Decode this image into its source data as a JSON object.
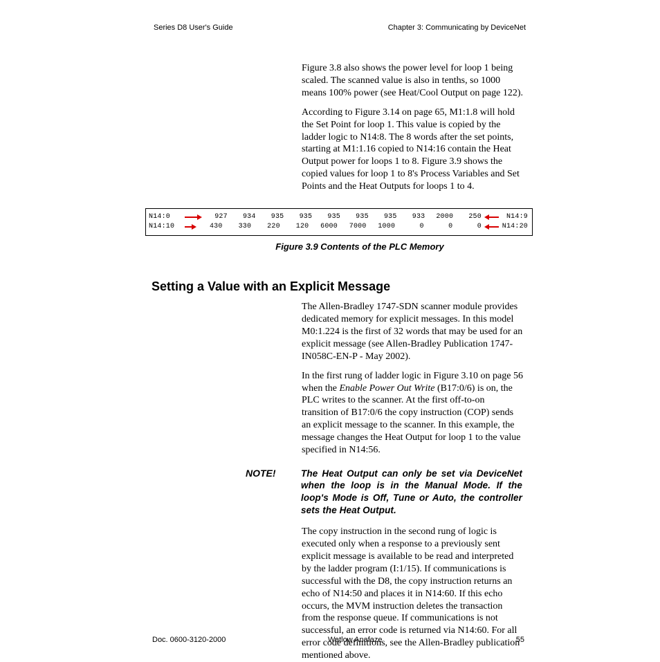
{
  "header": {
    "left": "Series D8 User's Guide",
    "right": "Chapter 3: Communicating by DeviceNet"
  },
  "body": {
    "para1": "Figure 3.8 also shows the power level for loop 1 being scaled. The scanned value is also in tenths, so 1000 means 100% power (see Heat/Cool Output on page 122).",
    "para2": "According to Figure 3.14 on page 65, M1:1.8 will hold the Set Point for loop 1. This value is copied by the ladder logic to N14:8. The 8 words after the set points, starting at M1:1.16 copied to N14:16 contain the Heat Output power for loops 1 to 8. Figure 3.9 shows the copied values for loop 1 to 8's Process Variables and Set Points and the Heat Outputs for loops 1 to 4.",
    "para3_a": "The Allen-Bradley 1747-SDN scanner module provides dedicated memory for explicit messages. In this model M0:1.224 is the first of 32 words that may be used for an explicit message (see Allen-Bradley Publication 1747-IN058C-EN-P - May 2002).",
    "para3_b_pre": "In the first rung of ladder logic in Figure 3.10 on page 56 when the ",
    "para3_b_em": "Enable Power Out Write",
    "para3_b_post": " (B17:0/6) is on, the PLC writes to the scanner. At the first off-to-on transition of B17:0/6 the copy instruction (COP) sends an explicit message to the scanner. In this example, the message changes the Heat Output for loop 1 to the value specified in N14:56.",
    "para4": "The copy instruction in the second rung of logic is executed only when a response to a previously sent explicit message is available to be read and interpreted by the ladder program (I:1/15). If communications is successful with the D8, the copy instruction returns an echo of N14:50 and places it in N14:60. If this echo occurs, the MVM instruction deletes the transaction from the response queue. If communications is not successful, an error code is returned via N14:60. For all error code definitions, see the Allen-Bradley publication mentioned above."
  },
  "figure": {
    "row1": {
      "left_label": "N14:0",
      "values": [
        "927",
        "934",
        "935",
        "935",
        "935",
        "935",
        "935",
        "933",
        "2000",
        "250"
      ],
      "right_label": "N14:9"
    },
    "row2": {
      "left_label": "N14:10",
      "values": [
        "430",
        "330",
        "220",
        "120",
        "6000",
        "7000",
        "1000",
        "0",
        "0",
        "0"
      ],
      "right_label": "N14:20"
    },
    "caption": "Figure 3.9    Contents of the PLC Memory"
  },
  "heading": "Setting a Value with an Explicit Message",
  "note": {
    "label": "NOTE!",
    "text": "The Heat Output can only be set via DeviceNet when the loop is in the Manual Mode. If the loop's Mode is Off, Tune or Auto, the controller sets the Heat Output."
  },
  "footer": {
    "left": "Doc. 0600-3120-2000",
    "mid": "Watlow Anafaze",
    "right": "55"
  }
}
